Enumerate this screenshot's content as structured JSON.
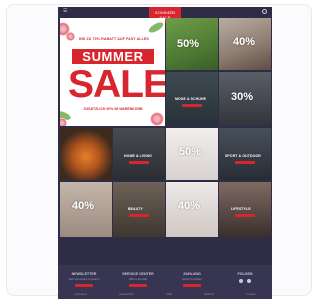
{
  "logo": {
    "text": "SOMMER SALE"
  },
  "hero": {
    "tagline": "BIS ZU 70% RABATT AUF FAST ALLES",
    "badge": "SUMMER",
    "title": "SALE",
    "subline": "ZUSÄTZLICH 20% IM WARENKORB"
  },
  "tiles": [
    {
      "pct": "50%",
      "caption": ""
    },
    {
      "pct": "40%",
      "caption": ""
    },
    {
      "pct": "",
      "caption": "MODE & SCHUHE"
    },
    {
      "pct": "30%",
      "caption": ""
    },
    {
      "pct": "",
      "caption": ""
    },
    {
      "pct": "",
      "caption": "HOME & LIVING"
    },
    {
      "pct": "50%",
      "caption": ""
    },
    {
      "pct": "",
      "caption": "SPORT & OUTDOOR"
    },
    {
      "pct": "40%",
      "caption": ""
    },
    {
      "pct": "",
      "caption": "BEAUTY"
    },
    {
      "pct": "40%",
      "caption": ""
    },
    {
      "pct": "",
      "caption": "LIFESTYLE"
    }
  ],
  "footer": {
    "columns": [
      {
        "title": "NEWSLETTER",
        "sub": "Jetzt anmelden & sparen"
      },
      {
        "title": "SERVICE CENTER",
        "sub": "Hilfe & Kontakt"
      },
      {
        "title": "ZAHLUNG",
        "sub": "Sicher bezahlen"
      },
      {
        "title": "FOLGEN",
        "sub": ""
      }
    ],
    "legal": [
      "Impressum",
      "Datenschutz",
      "AGB",
      "Widerruf",
      "Cookies"
    ]
  }
}
